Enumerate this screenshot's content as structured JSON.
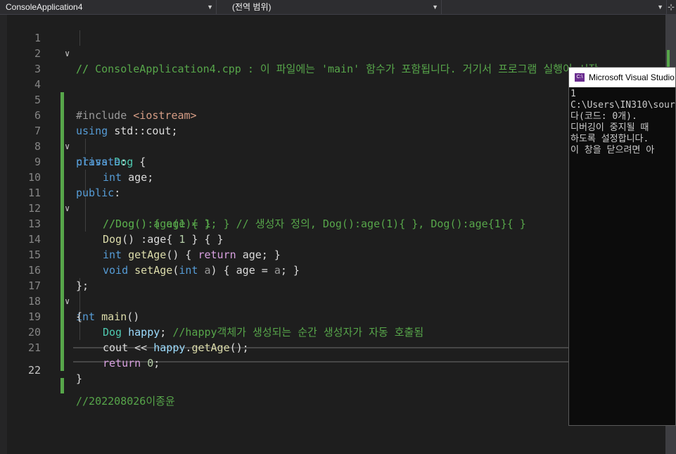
{
  "navbar": {
    "project": "ConsoleApplication4",
    "scope": "(전역 범위)",
    "member": ""
  },
  "colors": {
    "change_marker": "#57a64a",
    "comment": "#57a64a",
    "keyword": "#569cd6"
  },
  "editor": {
    "active_line": "22",
    "line_numbers": [
      "1",
      "2",
      "3",
      "4",
      "5",
      "6",
      "7",
      "8",
      "9",
      "10",
      "11",
      "12",
      "13",
      "14",
      "15",
      "16",
      "17",
      "18",
      "19",
      "20",
      "21",
      "22"
    ],
    "lines": {
      "l1": "// ConsoleApplication4.cpp : 이 파일에는 'main' 함수가 포함됩니다. 거기서 프로그램 실행이 시작",
      "l2": "//",
      "l4a": "#include ",
      "l4b": "<iostream>",
      "l5a": "using ",
      "l5b": "std::cout;",
      "l6a": "class ",
      "l6b": "Dog",
      "l6c": " {",
      "l7a": "private",
      "l7b": ":",
      "l8a": "int ",
      "l8b": "age;",
      "l9a": "public",
      "l9b": ":",
      "l10": "//Dog() { age = 1; } // 생성자 정의, Dog():age(1){ }, Dog():age{1}{ }",
      "l11": "//Dog():age(1){ }",
      "l12a": "Dog",
      "l12b": "() :",
      "l12c": "age",
      "l12d": "{ ",
      "l12e": "1",
      "l12f": " } { }",
      "l13a": "int ",
      "l13b": "getAge",
      "l13c": "() { ",
      "l13d": "return ",
      "l13e": "age",
      "l13f": "; }",
      "l14a": "void ",
      "l14b": "setAge",
      "l14c": "(",
      "l14d": "int ",
      "l14e": "a",
      "l14f": ") { ",
      "l14g": "age",
      "l14h": " = ",
      "l14i": "a",
      "l14j": "; }",
      "l15": "};",
      "l16a": "int ",
      "l16b": "main",
      "l16c": "()",
      "l17": "{",
      "l18a": "Dog ",
      "l18b": "happy",
      "l18c": "; ",
      "l18d": "//happy객체가 생성되는 순간 생성자가 자동 호출됨",
      "l19a": "cout",
      "l19b": " << ",
      "l19c": "happy",
      "l19d": ".",
      "l19e": "getAge",
      "l19f": "();",
      "l20a": "return ",
      "l20b": "0",
      "l20c": ";",
      "l21": "}",
      "l22": "//202208026이종윤"
    }
  },
  "console": {
    "title": "Microsoft Visual Studio",
    "icon_label": "C:\\",
    "output": "1\nC:\\Users\\IN310\\sour\n다(코드: 0개).\n디버깅이 중지될 때\n하도록 설정합니다.\n이 창을 닫으려면 아"
  }
}
